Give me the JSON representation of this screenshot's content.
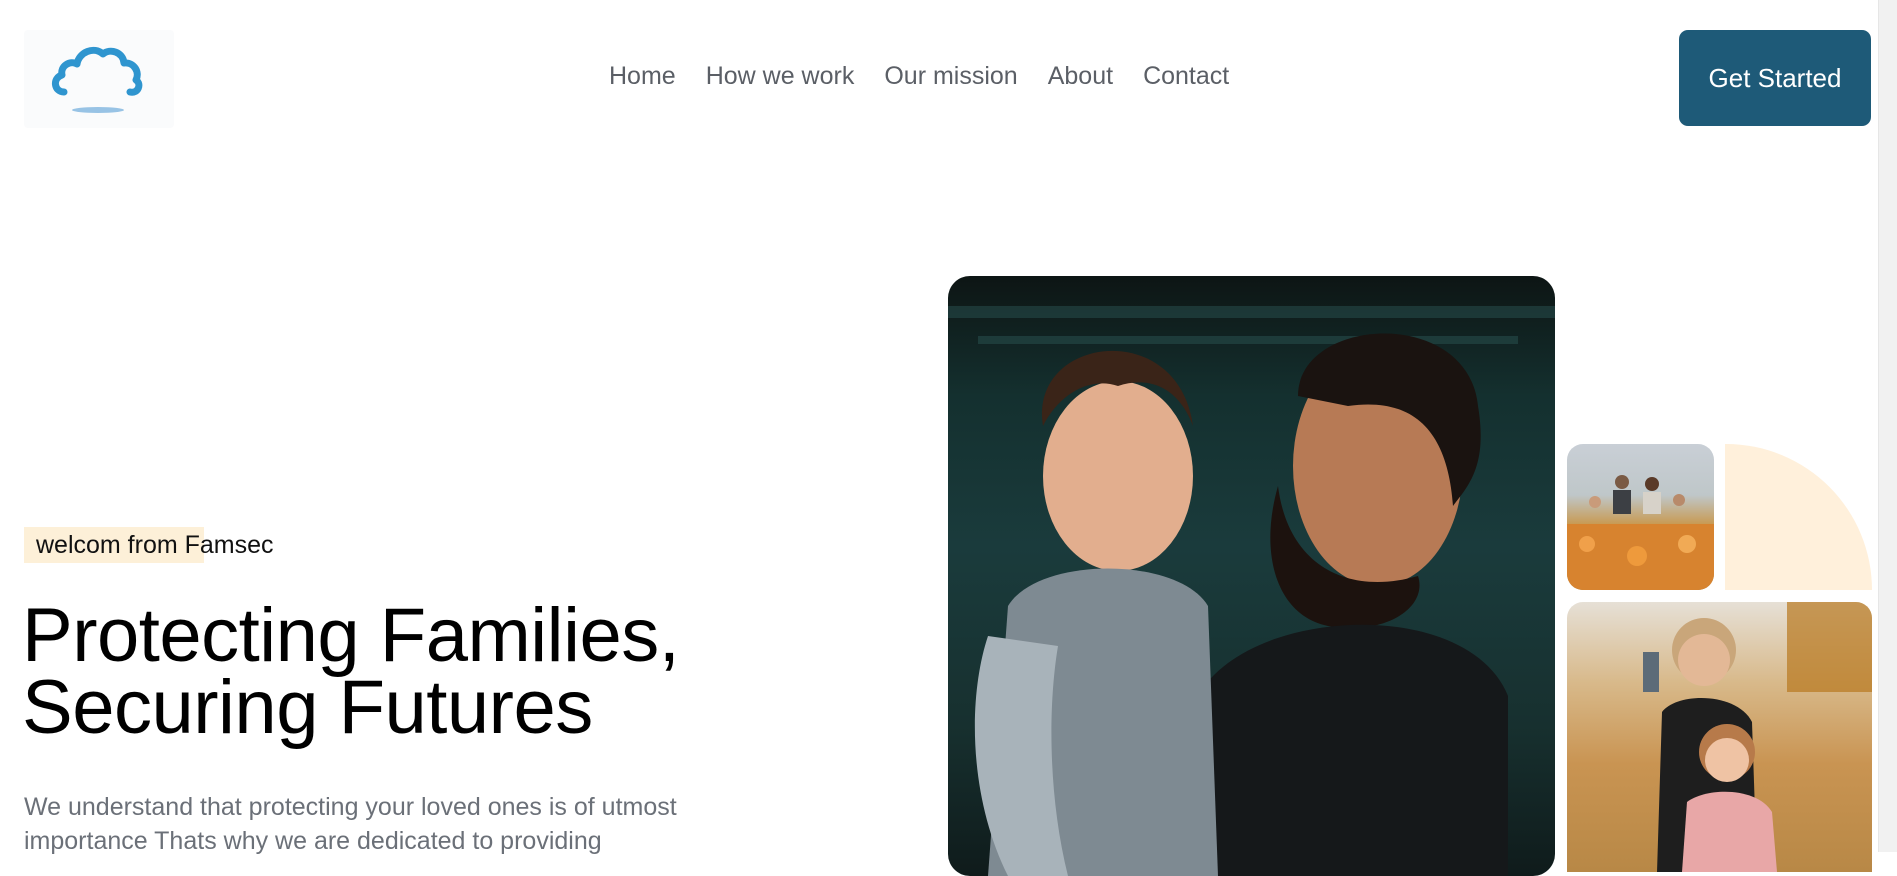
{
  "header": {
    "logo": {
      "icon": "cloud-icon",
      "color": "#2f95cf"
    },
    "nav": [
      {
        "label": "Home"
      },
      {
        "label": "How we work"
      },
      {
        "label": "Our mission"
      },
      {
        "label": "About"
      },
      {
        "label": "Contact"
      }
    ],
    "cta_label": "Get Started",
    "cta_color": "#1e5a78"
  },
  "hero": {
    "eyebrow": "welcom from Famsec",
    "headline_line1": "Protecting Families,",
    "headline_line2": "Securing Futures",
    "description": "We understand that protecting your loved ones is of utmost importance Thats why we are dedicated to providing"
  },
  "images": {
    "main": "father-kissing-child-photo",
    "small_top": "family-in-flower-field-photo",
    "small_bottom": "children-hugging-in-field-photo"
  },
  "accent_color": "#fff0db"
}
